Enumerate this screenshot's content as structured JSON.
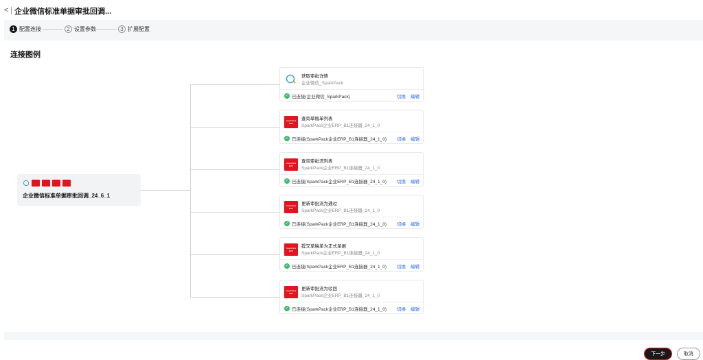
{
  "header": {
    "back_icon": "chevron-left-icon",
    "back_glyph": "<",
    "title": "企业微信标准单据审批回调..."
  },
  "steps": [
    {
      "num": "1",
      "label": "配置连接",
      "active": true
    },
    {
      "num": "2",
      "label": "设置参数",
      "active": false
    },
    {
      "num": "3",
      "label": "扩展配置",
      "active": false
    }
  ],
  "section_title": "连接图例",
  "source": {
    "name": "企业微信标准单据审批回调_24_6_1",
    "icons": [
      "wecom-icon",
      "sparkpack-icon",
      "sparkpack-icon",
      "sparkpack-icon",
      "sparkpack-icon"
    ]
  },
  "targets": [
    {
      "icon": "wecom-icon",
      "name": "获取审批详情",
      "connector": "企业微信_SparkPack",
      "status": "已连接(企业微信_SparkPack)",
      "switch": "切换",
      "edit": "编辑"
    },
    {
      "icon": "sparkpack-icon",
      "name": "查询草稿单列表",
      "connector": "SparkPack企业ERP_B1连接器_24_1_0",
      "status": "已连接(SparkPack企业ERP_B1连接器_24_1_0)",
      "switch": "切换",
      "edit": "编辑"
    },
    {
      "icon": "sparkpack-icon",
      "name": "查询审批流列表",
      "connector": "SparkPack企业ERP_B1连接器_24_1_0",
      "status": "已连接(SparkPack企业ERP_B1连接器_24_1_0)",
      "switch": "切换",
      "edit": "编辑"
    },
    {
      "icon": "sparkpack-icon",
      "name": "更新审批流为通过",
      "connector": "SparkPack企业ERP_B1连接器_24_1_0",
      "status": "已连接(SparkPack企业ERP_B1连接器_24_1_0)",
      "switch": "切换",
      "edit": "编辑"
    },
    {
      "icon": "sparkpack-icon",
      "name": "提交草稿单为正式单据",
      "connector": "SparkPack企业ERP_B1连接器_24_1_0",
      "status": "已连接(SparkPack企业ERP_B1连接器_24_1_0)",
      "switch": "切换",
      "edit": "编辑"
    },
    {
      "icon": "sparkpack-icon",
      "name": "更新审批流为驳回",
      "connector": "SparkPack企业ERP_B1连接器_24_1_0",
      "status": "已连接(SparkPack企业ERP_B1连接器_24_1_0)",
      "switch": "切换",
      "edit": "编辑"
    }
  ],
  "sparkpack_logo_text": "SparkPack ERP",
  "footer": {
    "next": "下一步",
    "cancel": "取消"
  },
  "colors": {
    "accent": "#2a6ee9",
    "brand_red": "#e1141f",
    "success": "#3dbb6e"
  }
}
